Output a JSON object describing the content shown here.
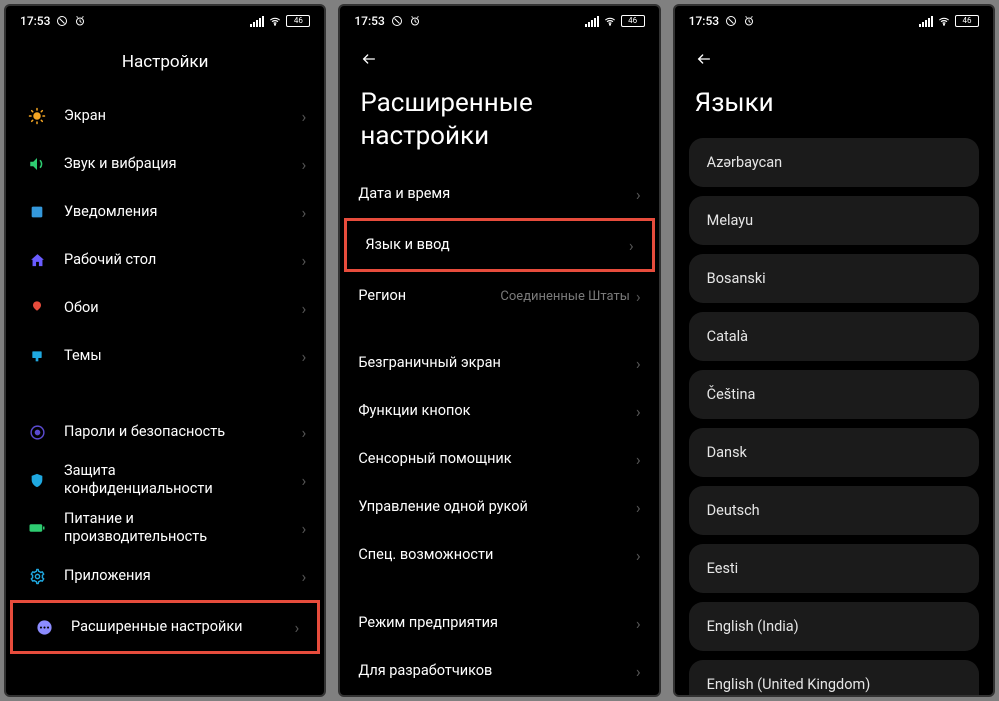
{
  "status": {
    "time": "17:53",
    "battery": "46"
  },
  "screen1": {
    "title": "Настройки",
    "items": [
      {
        "label": "Экран",
        "icon": "sun",
        "color": "#f5a623"
      },
      {
        "label": "Звук и вибрация",
        "icon": "sound",
        "color": "#2ecc71"
      },
      {
        "label": "Уведомления",
        "icon": "notify",
        "color": "#3498db"
      },
      {
        "label": "Рабочий стол",
        "icon": "home",
        "color": "#6a5cff"
      },
      {
        "label": "Обои",
        "icon": "wallpaper",
        "color": "#e74c3c"
      },
      {
        "label": "Темы",
        "icon": "theme",
        "color": "#1fa8e0"
      }
    ],
    "items2": [
      {
        "label": "Пароли и безопасность",
        "icon": "lock",
        "color": "#5b4bd1"
      },
      {
        "label": "Защита\nконфиденциальности",
        "icon": "shield",
        "color": "#1fa8e0"
      },
      {
        "label": "Питание и\nпроизводительность",
        "icon": "battery",
        "color": "#2ecc71"
      },
      {
        "label": "Приложения",
        "icon": "apps",
        "color": "#1fa8e0"
      },
      {
        "label": "Расширенные настройки",
        "icon": "dots",
        "color": "#8c8cff",
        "highlight": true
      }
    ]
  },
  "screen2": {
    "title": "Расширенные\nнастройки",
    "items": [
      {
        "label": "Дата и время"
      },
      {
        "label": "Язык и ввод",
        "highlight": true
      },
      {
        "label": "Регион",
        "sub": "Соединенные Штаты"
      }
    ],
    "items2": [
      {
        "label": "Безграничный экран"
      },
      {
        "label": "Функции кнопок"
      },
      {
        "label": "Сенсорный помощник"
      },
      {
        "label": "Управление одной рукой"
      },
      {
        "label": "Спец. возможности"
      }
    ],
    "items3": [
      {
        "label": "Режим предприятия"
      },
      {
        "label": "Для разработчиков"
      }
    ]
  },
  "screen3": {
    "title": "Языки",
    "langs": [
      "Azərbaycan",
      "Melayu",
      "Bosanski",
      "Català",
      "Čeština",
      "Dansk",
      "Deutsch",
      "Eesti",
      "English (India)",
      "English (United Kingdom)"
    ]
  }
}
